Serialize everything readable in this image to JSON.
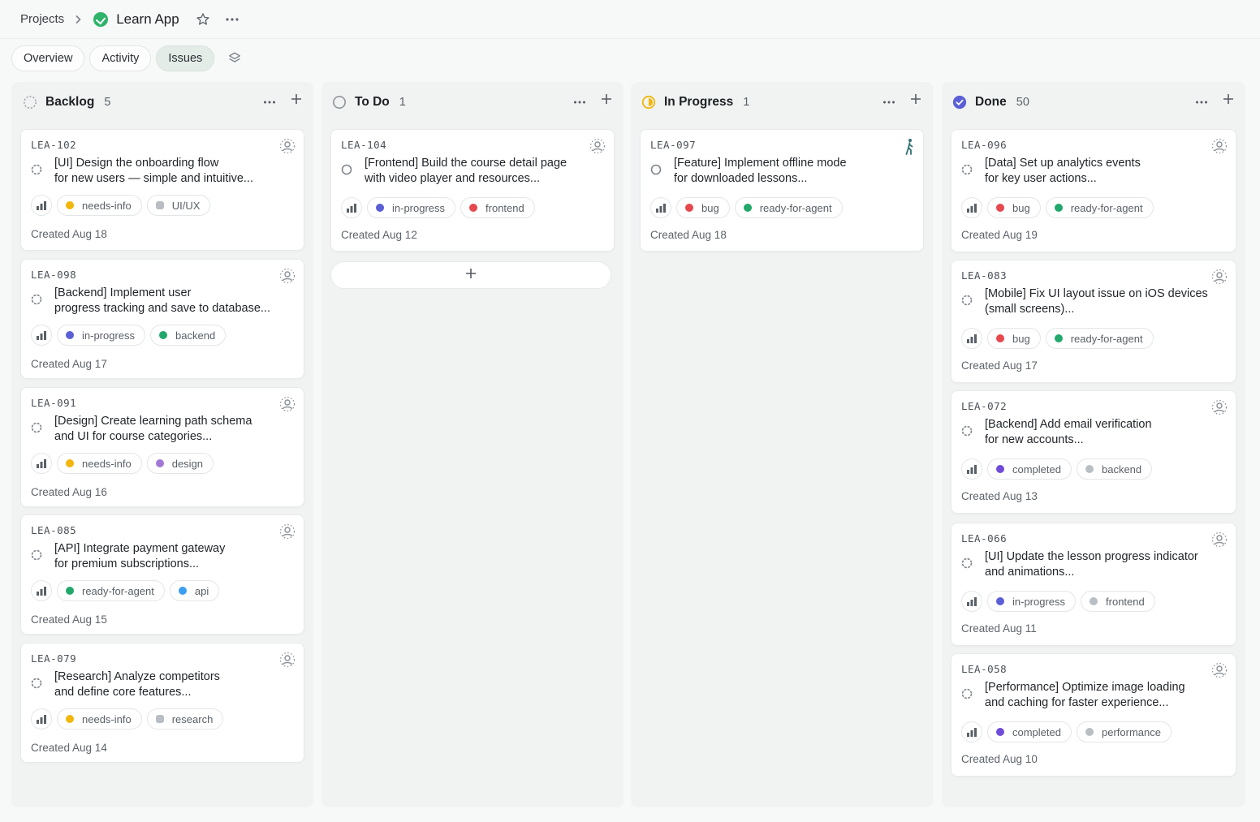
{
  "breadcrumb": {
    "root": "Projects",
    "project": "Learn App"
  },
  "tabs": [
    {
      "label": "Overview",
      "active": false
    },
    {
      "label": "Activity",
      "active": false
    },
    {
      "label": "Issues",
      "active": true
    }
  ],
  "colors": {
    "needs-info": "#f2b60c",
    "in-progress": "#5b5fd6",
    "ready-for-agent": "#22a86b",
    "bug": "#e5484d",
    "frontend": "#e5484d",
    "backend": "#22a86b",
    "design": "#a07ad6",
    "api": "#3b9ef0",
    "completed": "#6f4bd8",
    "gray": "#b9bec4"
  },
  "columns": [
    {
      "title": "Backlog",
      "count": "5",
      "status": "backlog-icon",
      "cards": [
        {
          "id": "LEA-102",
          "title_lines": [
            "[UI] Design the onboarding flow",
            "for new users — simple and intuitive..."
          ],
          "tags": [
            [
              "needs-info",
              "needs-info"
            ],
            [
              "UI/UX",
              "gray"
            ]
          ],
          "date": "Created Aug 18"
        },
        {
          "id": "LEA-098",
          "title_lines": [
            "[Backend] Implement user",
            "progress tracking and save to database..."
          ],
          "tags": [
            [
              "in-progress",
              "in-progress"
            ],
            [
              "backend",
              "backend"
            ]
          ],
          "date": "Created Aug 17"
        },
        {
          "id": "LEA-091",
          "title_lines": [
            "[Design] Create learning path schema",
            "and UI for course categories..."
          ],
          "tags": [
            [
              "needs-info",
              "needs-info"
            ],
            [
              "design",
              "design"
            ]
          ],
          "date": "Created Aug 16"
        },
        {
          "id": "LEA-085",
          "title_lines": [
            "[API] Integrate payment gateway",
            "for premium subscriptions..."
          ],
          "tags": [
            [
              "ready-for-agent",
              "ready-for-agent"
            ],
            [
              "api",
              "api"
            ]
          ],
          "date": "Created Aug 15"
        },
        {
          "id": "LEA-079",
          "title_lines": [
            "[Research] Analyze competitors",
            "and define core features..."
          ],
          "tags": [
            [
              "needs-info",
              "needs-info"
            ],
            [
              "research",
              "gray"
            ]
          ],
          "date": "Created Aug 14"
        }
      ]
    },
    {
      "title": "To Do",
      "count": "1",
      "status": "todo-icon",
      "cards": [
        {
          "id": "LEA-104",
          "title_lines": [
            "[Frontend] Build the course detail page",
            "with video player and resources..."
          ],
          "tags": [
            [
              "in-progress",
              "in-progress"
            ],
            [
              "frontend",
              "frontend"
            ]
          ],
          "date": "Created Aug 12"
        }
      ]
    },
    {
      "title": "In Progress",
      "count": "1",
      "status": "in-progress-icon",
      "cards": [
        {
          "id": "LEA-097",
          "title_lines": [
            "[Feature] Implement offline mode",
            "for downloaded lessons..."
          ],
          "tags": [
            [
              "bug",
              "bug"
            ],
            [
              "ready-for-agent",
              "ready-for-agent"
            ]
          ],
          "date": "Created Aug 18"
        }
      ]
    },
    {
      "title": "Done",
      "count": "50",
      "status": "done-icon",
      "cards": [
        {
          "id": "LEA-096",
          "title_lines": [
            "[Data] Set up analytics events",
            "for key user actions..."
          ],
          "tags": [
            [
              "bug",
              "bug"
            ],
            [
              "ready-for-agent",
              "ready-for-agent"
            ]
          ],
          "date": "Created Aug 19"
        },
        {
          "id": "LEA-083",
          "title_lines": [
            "[Mobile] Fix UI layout issue on iOS devices",
            "(small screens)..."
          ],
          "tags": [
            [
              "bug",
              "bug"
            ],
            [
              "ready-for-agent",
              "ready-for-agent"
            ]
          ],
          "date": "Created Aug 17"
        },
        {
          "id": "LEA-072",
          "title_lines": [
            "[Backend] Add email verification",
            "for new accounts..."
          ],
          "tags": [
            [
              "completed",
              "completed"
            ],
            [
              "backend",
              "gray"
            ]
          ],
          "date": "Created Aug 13"
        },
        {
          "id": "LEA-066",
          "title_lines": [
            "[UI] Update the lesson progress indicator",
            "and animations..."
          ],
          "tags": [
            [
              "in-progress",
              "in-progress"
            ],
            [
              "frontend",
              "gray"
            ]
          ],
          "date": "Created Aug 11"
        },
        {
          "id": "LEA-058",
          "title_lines": [
            "[Performance] Optimize image loading",
            "and caching for faster experience..."
          ],
          "tags": [
            [
              "completed",
              "completed"
            ],
            [
              "performance",
              "gray"
            ]
          ],
          "date": "Created Aug 10"
        }
      ]
    }
  ]
}
